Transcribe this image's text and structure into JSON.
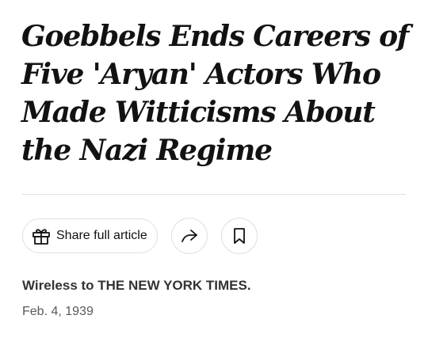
{
  "article": {
    "headline": "Goebbels Ends Careers of Five 'Aryan' Actors Who Made Witticisms About the Nazi Regime",
    "byline": "Wireless to THE NEW YORK TIMES.",
    "date": "Feb. 4, 1939"
  },
  "share_bar": {
    "share_full_article_label": "Share full article",
    "icons": {
      "gift": "gift-icon",
      "share": "share-arrow-icon",
      "save": "bookmark-icon"
    }
  },
  "colors": {
    "text": "#121212",
    "byline": "#333333",
    "date": "#5a5a5a",
    "border": "#dfdfdf",
    "divider": "#e2e2e2"
  }
}
